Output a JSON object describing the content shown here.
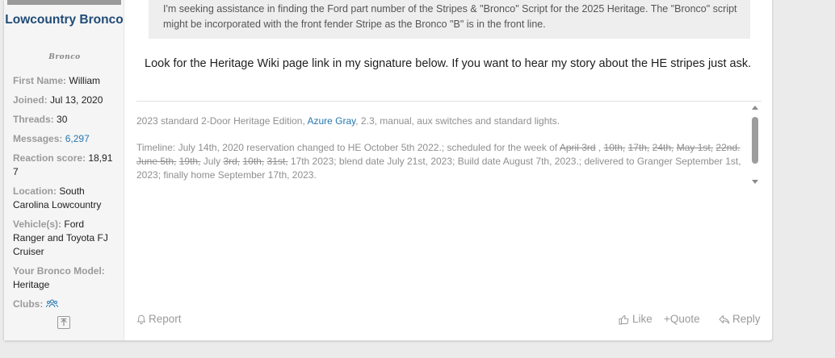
{
  "user": {
    "name": "Lowcountry Bronco",
    "badge": "Bronco",
    "fields": [
      {
        "label": "First Name:",
        "value": "William"
      },
      {
        "label": "Joined:",
        "value": "Jul 13, 2020"
      },
      {
        "label": "Threads:",
        "value": "30"
      },
      {
        "label": "Messages:",
        "value": "6,297"
      },
      {
        "label": "Reaction score:",
        "value": "18,917"
      },
      {
        "label": "Location:",
        "value": "South Carolina Lowcountry"
      },
      {
        "label": "Vehicle(s):",
        "value": "Ford Ranger and Toyota FJ Cruiser"
      },
      {
        "label": "Your Bronco Model:",
        "value": "Heritage"
      },
      {
        "label": "Clubs:",
        "value": ""
      }
    ]
  },
  "quote": {
    "text": "I'm seeking assistance in finding the Ford part number of the Stripes & \"Bronco\" Script for the 2025 Heritage. The \"Bronco\" script might be incorporated with the front fender Stripe as the Bronco \"B\" is in the front line."
  },
  "message": {
    "text": "Look for the Heritage Wiki page link in my signature below. If you want to hear my story about the HE stripes just ask."
  },
  "signature": {
    "line1_a": "2023 standard 2-Door Heritage Edition, ",
    "line1_link": "Azure Gray",
    "line1_b": ", 2.3, manual, aux switches and standard lights.",
    "timeline": [
      {
        "t": "Timeline: July 14th, 2020 reservation changed to HE October 5th 2022.; scheduled for the week of ",
        "s": false
      },
      {
        "t": "April 3rd",
        "s": true
      },
      {
        "t": " , ",
        "s": false
      },
      {
        "t": "10th,",
        "s": true
      },
      {
        "t": " ",
        "s": false
      },
      {
        "t": "17th,",
        "s": true
      },
      {
        "t": " ",
        "s": false
      },
      {
        "t": "24th,",
        "s": true
      },
      {
        "t": " ",
        "s": false
      },
      {
        "t": "May 1st,",
        "s": true
      },
      {
        "t": " ",
        "s": false
      },
      {
        "t": "22nd.",
        "s": true
      },
      {
        "t": " ",
        "s": false
      },
      {
        "t": "June 5th,",
        "s": true
      },
      {
        "t": " ",
        "s": false
      },
      {
        "t": "19th,",
        "s": true
      },
      {
        "t": " July ",
        "s": false
      },
      {
        "t": "3rd,",
        "s": true
      },
      {
        "t": " ",
        "s": false
      },
      {
        "t": "10th,",
        "s": true
      },
      {
        "t": " ",
        "s": false
      },
      {
        "t": "31st,",
        "s": true
      },
      {
        "t": " 17th 2023; blend date July 21st, 2023; Build date August 7th, 2023.; delivered to Granger September 1st, 2023; finally home September 17th, 2023.",
        "s": false
      }
    ]
  },
  "actions": {
    "report": "Report",
    "like": "Like",
    "quote": "+Quote",
    "reply": "Reply"
  },
  "icons": {
    "clubs": "users-icon",
    "up": "arrow-up-icon",
    "report": "bell-icon",
    "like": "thumbs-up-icon",
    "reply": "reply-icon"
  },
  "colors": {
    "username": "#1f4a75",
    "link": "#2577b1",
    "muted": "#9a9a9a"
  }
}
